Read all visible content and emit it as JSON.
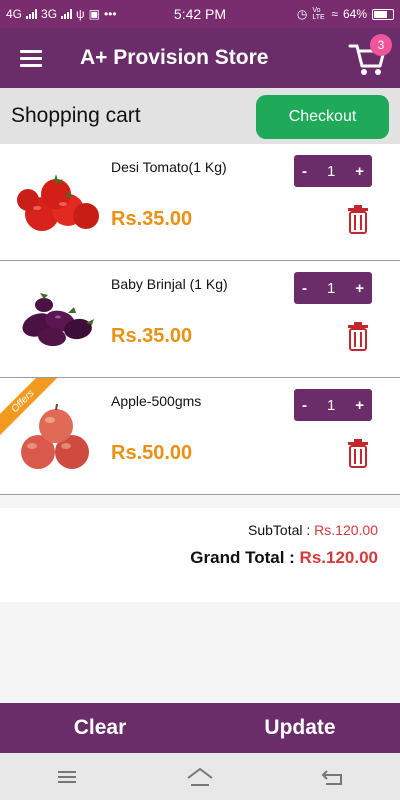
{
  "status_bar": {
    "network1": "4G",
    "network2": "3G",
    "time": "5:42 PM",
    "volte": "Vo LTE",
    "battery": "64%"
  },
  "app_bar": {
    "title": "A+ Provision Store",
    "cart_count": "3"
  },
  "cart": {
    "title": "Shopping cart",
    "checkout_label": "Checkout"
  },
  "items": [
    {
      "name": "Desi Tomato(1 Kg)",
      "price": "Rs.35.00",
      "qty": "1",
      "image": "tomatoes"
    },
    {
      "name": "Baby Brinjal (1 Kg)",
      "price": "Rs.35.00",
      "qty": "1",
      "image": "brinjals"
    },
    {
      "name": "Apple-500gms",
      "price": "Rs.50.00",
      "qty": "1",
      "image": "apples",
      "badge": "Offers"
    }
  ],
  "stepper": {
    "minus": "-",
    "plus": "+"
  },
  "totals": {
    "subtotal_label": "SubTotal : ",
    "subtotal_value": "Rs.120.00",
    "grandtotal_label": "Grand Total : ",
    "grandtotal_value": "Rs.120.00"
  },
  "bottom_bar": {
    "clear_label": "Clear",
    "update_label": "Update"
  },
  "colors": {
    "primary": "#6b2c6a",
    "checkout": "#1eaa58",
    "price": "#e89112",
    "total_value": "#d63a3a",
    "badge": "#f0559a"
  }
}
